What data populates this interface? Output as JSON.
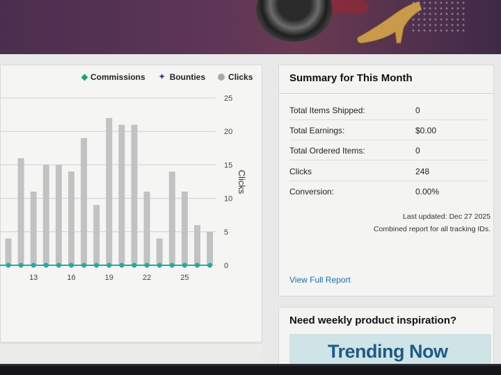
{
  "legend": {
    "commissions": "Commissions",
    "bounties": "Bounties",
    "clicks": "Clicks"
  },
  "chart_data": {
    "type": "bar",
    "y_axis_label": "Clicks",
    "ylim": [
      0,
      25
    ],
    "y_ticks": [
      "0",
      "5",
      "10",
      "15",
      "20",
      "25"
    ],
    "x_tick_labels": [
      "13",
      "16",
      "19",
      "22",
      "25"
    ],
    "categories": [
      "11",
      "12",
      "13",
      "14",
      "15",
      "16",
      "17",
      "18",
      "19",
      "20",
      "21",
      "22",
      "23",
      "24",
      "25",
      "26",
      "27"
    ],
    "series": [
      {
        "name": "Clicks",
        "values": [
          4,
          16,
          11,
          15,
          15,
          14,
          19,
          9,
          22,
          21,
          21,
          11,
          4,
          14,
          11,
          6,
          5
        ]
      },
      {
        "name": "Commissions",
        "values": [
          0,
          0,
          0,
          0,
          0,
          0,
          0,
          0,
          0,
          0,
          0,
          0,
          0,
          0,
          0,
          0,
          0
        ]
      }
    ],
    "colors": {
      "bars": "#c2c2c2",
      "commissions": "#2aa6a0",
      "grid": "#cfcfcf"
    }
  },
  "summary": {
    "title": "Summary for This Month",
    "rows": [
      {
        "label": "Total Items Shipped:",
        "value": "0"
      },
      {
        "label": "Total Earnings:",
        "value": "$0.00"
      },
      {
        "label": "Total Ordered Items:",
        "value": "0"
      },
      {
        "label": "Clicks",
        "value": "248"
      },
      {
        "label": "Conversion:",
        "value": "0.00%"
      }
    ],
    "last_updated": "Last updated: Dec 27 2025",
    "combined_note": "Combined report for all tracking IDs.",
    "view_report": "View Full Report"
  },
  "inspiration": {
    "title": "Need weekly product inspiration?",
    "banner_text": "Trending Now"
  }
}
